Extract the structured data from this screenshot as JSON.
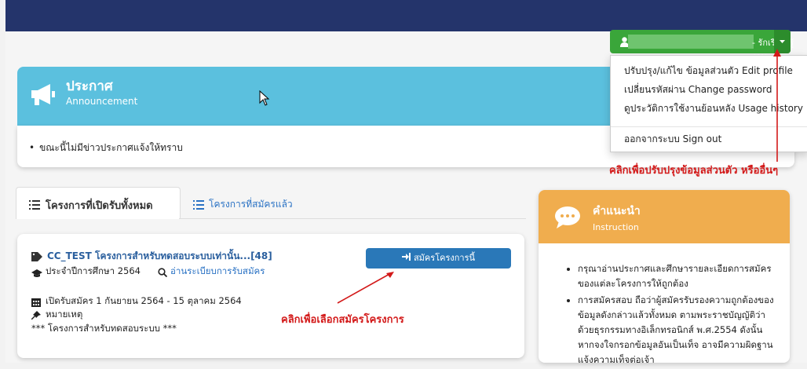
{
  "user": {
    "name_suffix": "- รักเรียน รู้งาน",
    "menu": [
      "ปรับปรุง/แก้ไข ข้อมูลส่วนตัว Edit profile",
      "เปลี่ยนรหัสผ่าน Change password",
      "ดูประวัติการใช้งานย้อนหลัง Usage history",
      "ออกจากระบบ Sign out"
    ]
  },
  "announcement": {
    "title": "ประกาศ",
    "subtitle": "Announcement",
    "text": "ขณะนี้ไม่มีข่าวประกาศแจ้งให้ทราบ"
  },
  "tabs": {
    "active": "โครงการที่เปิดรับทั้งหมด",
    "other": "โครงการที่สมัครแล้ว"
  },
  "project": {
    "title": "CC_TEST โครงการสำหรับทดสอบระบบเท่านั้น...[48]",
    "year_label": "ประจำปีการศึกษา 2564",
    "rules_link": "อ่านระเบียบการรับสมัคร",
    "apply_button": "สมัครโครงการนี้",
    "open_period": "เปิดรับสมัคร 1 กันยายน 2564 - 15 ตุลาคม 2564",
    "remark_label": "หมายเหตุ",
    "remark_text": "*** โครงการสำหรับทดสอบระบบ ***"
  },
  "annotations": {
    "profile_note": "คลิกเพื่อปรับปรุงข้อมูลส่วนตัว หรืออื่นๆ",
    "apply_note": "คลิกเพื่อเลือกสมัครโครงการ"
  },
  "instruction": {
    "title": "คำแนะนำ",
    "subtitle": "Instruction",
    "items": [
      "กรุณาอ่านประกาศและศึกษารายละเอียดการสมัคร ของแต่ละโครงการให้ถูกต้อง",
      "การสมัครสอบ ถือว่าผู้สมัครรับรองความถูกต้องของข้อมูลดังกล่าวแล้วทั้งหมด ตามพระราชบัญญัติว่าด้วยธุรกรรมทางอิเล็กทรอนิกส์ พ.ศ.2554 ดังนั้นหากจงใจกรอกข้อมูลอันเป็นเท็จ อาจมีความผิดฐานแจ้งความเท็จต่อเจ้า"
    ]
  },
  "colors": {
    "navbar": "#24346b",
    "announcement": "#5bc0de",
    "instruction": "#f0ad4e",
    "user_button": "#3aa63a",
    "apply_button": "#2a78b8",
    "annotation": "#d31a1a"
  }
}
